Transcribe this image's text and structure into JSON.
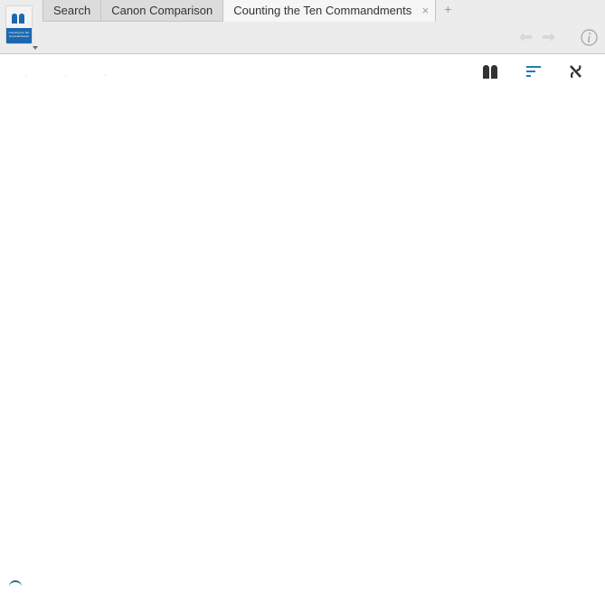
{
  "header": {
    "app_thumbnail": {
      "caption": "Counting the Ten Commandments",
      "icon": "tablets-icon"
    }
  },
  "tabs": [
    {
      "label": "Search",
      "active": false
    },
    {
      "label": "Canon Comparison",
      "active": false
    },
    {
      "label": "Counting the Ten Commandments",
      "active": true
    }
  ],
  "tab_close_glyph": "×",
  "tab_add_glyph": "+",
  "toolbar": {
    "back_icon": "arrow-left-icon",
    "forward_icon": "arrow-right-icon",
    "info_icon": "info-icon"
  },
  "content_toolbar": {
    "dots": "· · ·",
    "buttons": [
      {
        "icon": "tablets-icon"
      },
      {
        "icon": "align-left-icon",
        "accent": "#1d7fae"
      },
      {
        "icon": "hebrew-aleph-icon"
      }
    ]
  },
  "colors": {
    "header_bg": "#ececec",
    "tab_bg": "#dcdcdc",
    "active_tab_bg": "#f6f6f6",
    "accent_blue": "#1b68b1",
    "icon_dark": "#333333"
  }
}
